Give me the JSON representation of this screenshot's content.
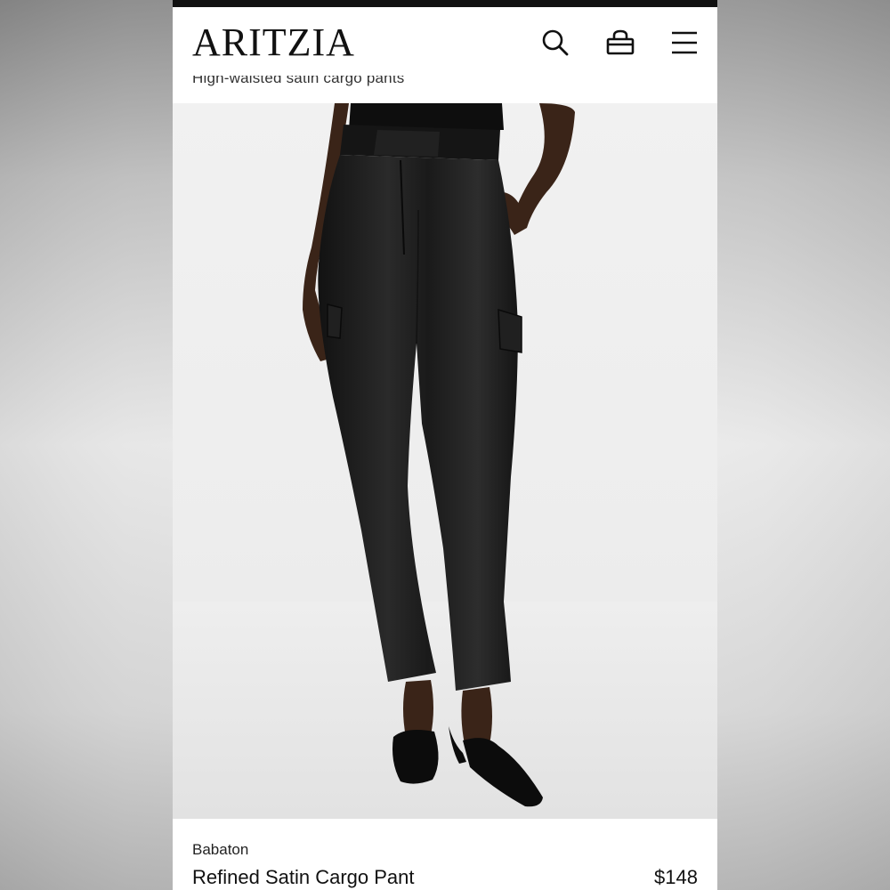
{
  "header": {
    "logo": "ARITZIA",
    "subtitle": "High-waisted satin cargo pants",
    "icons": [
      "search-icon",
      "bag-icon",
      "menu-icon"
    ]
  },
  "product": {
    "brand": "Babaton",
    "name": "Refined Satin Cargo Pant",
    "price": "$148",
    "image_alt": "Model wearing black satin cargo pants with pointed black mules"
  },
  "colors": {
    "text": "#111111",
    "background": "#ffffff",
    "garment": "#1b1b1b"
  }
}
